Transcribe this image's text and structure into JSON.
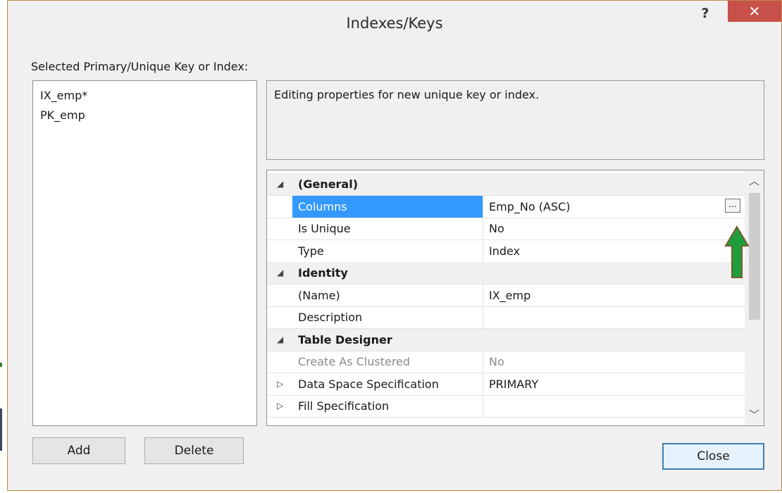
{
  "window": {
    "title": "Indexes/Keys",
    "help_label": "?",
    "close_label": "✕"
  },
  "selection": {
    "label": "Selected Primary/Unique Key or Index:",
    "items": [
      "IX_emp*",
      "PK_emp"
    ]
  },
  "description": "Editing properties for new unique key or index.",
  "properties": [
    {
      "type": "category",
      "expander": "◢",
      "name": "(General)"
    },
    {
      "type": "prop",
      "name": "Columns",
      "value": "Emp_No (ASC)",
      "selected": true,
      "ellipsis": "..."
    },
    {
      "type": "prop",
      "name": "Is Unique",
      "value": "No"
    },
    {
      "type": "prop",
      "name": "Type",
      "value": "Index"
    },
    {
      "type": "category",
      "expander": "◢",
      "name": "Identity"
    },
    {
      "type": "prop",
      "name": "(Name)",
      "value": "IX_emp"
    },
    {
      "type": "prop",
      "name": "Description",
      "value": ""
    },
    {
      "type": "category",
      "expander": "◢",
      "name": "Table Designer"
    },
    {
      "type": "prop",
      "name": "Create As Clustered",
      "value": "No",
      "dim": true
    },
    {
      "type": "prop",
      "expander": "▷",
      "name": "Data Space Specification",
      "value": "PRIMARY"
    },
    {
      "type": "prop",
      "expander": "▷",
      "name": "Fill Specification",
      "value": ""
    }
  ],
  "buttons": {
    "add": "Add",
    "delete": "Delete",
    "close": "Close"
  },
  "colors": {
    "selection": "#3399ff",
    "close_button": "#c7504a",
    "arrow_fill": "#1e9e3c",
    "arrow_stroke": "#7a5a2a"
  }
}
